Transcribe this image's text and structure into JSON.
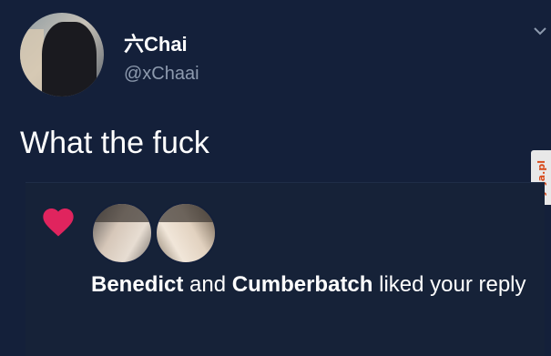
{
  "tweet": {
    "display_name": "六Chai",
    "handle": "@xChaai",
    "text": "What the fuck"
  },
  "notification": {
    "user1": "Benedict",
    "joiner": "and",
    "user2": "Cumberbatch",
    "action": "liked your reply"
  },
  "watermark": "jeja.pl",
  "colors": {
    "background": "#14203a",
    "heart": "#e0245e",
    "handle_gray": "#8d9aae"
  },
  "icons": [
    "chevron-down-icon",
    "heart-icon"
  ]
}
